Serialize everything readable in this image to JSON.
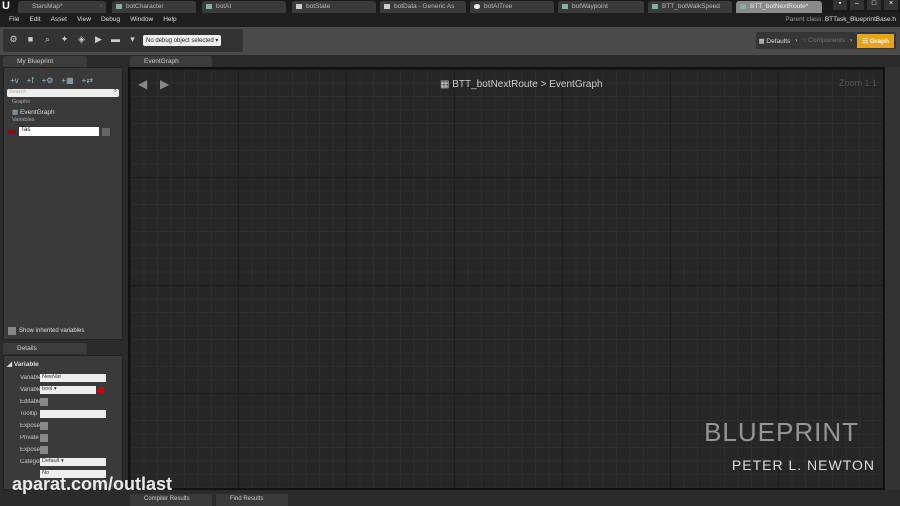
{
  "doc_tabs": [
    "StarsMap*",
    "botCharacter",
    "botAI",
    "botState",
    "botData - Generic As",
    "botAITree",
    "botWaypoint",
    "BTT_botWalkSpeed",
    "BTT_botNextRoute*"
  ],
  "menu": [
    "File",
    "Edit",
    "Asset",
    "View",
    "Debug",
    "Window",
    "Help"
  ],
  "parent_class": {
    "label": "Parent class:",
    "value": "BTTask_BlueprintBase.h"
  },
  "toolbar": {
    "debug_select": "No debug object selected"
  },
  "modes": {
    "defaults": "Defaults",
    "components": "Components",
    "graph": "Graph",
    "accent": "#e8a512"
  },
  "my_blueprint": {
    "title": "My Blueprint",
    "search_placeholder": "Search",
    "graphs_header": "Graphs",
    "event_graph": "EventGraph",
    "variables_header": "Variables",
    "var_edit_value": "Tas",
    "show_inherited": "Show inherited variables"
  },
  "details": {
    "title": "Details",
    "section": "Variable",
    "rows": [
      {
        "label": "Variable",
        "value": "NewVar"
      },
      {
        "label": "Variable",
        "value": "bool"
      },
      {
        "label": "Editable"
      },
      {
        "label": "Tooltip",
        "value": ""
      },
      {
        "label": "Expose"
      },
      {
        "label": "Private"
      },
      {
        "label": "Expose"
      },
      {
        "label": "Category",
        "value": "Default"
      },
      {
        "label": "",
        "value": "No"
      }
    ]
  },
  "graph": {
    "tab": "EventGraph",
    "breadcrumb_bp": "BTT_botNextRoute",
    "breadcrumb_sep": ">",
    "breadcrumb_graph": "EventGraph",
    "zoom": "Zoom 1:1"
  },
  "bottom_tabs": [
    "Compiler Results",
    "Find Results"
  ],
  "watermark": {
    "title": "BLUEPRINT",
    "author": "PETER L. NEWTON",
    "site": "aparat.com/outlast"
  }
}
